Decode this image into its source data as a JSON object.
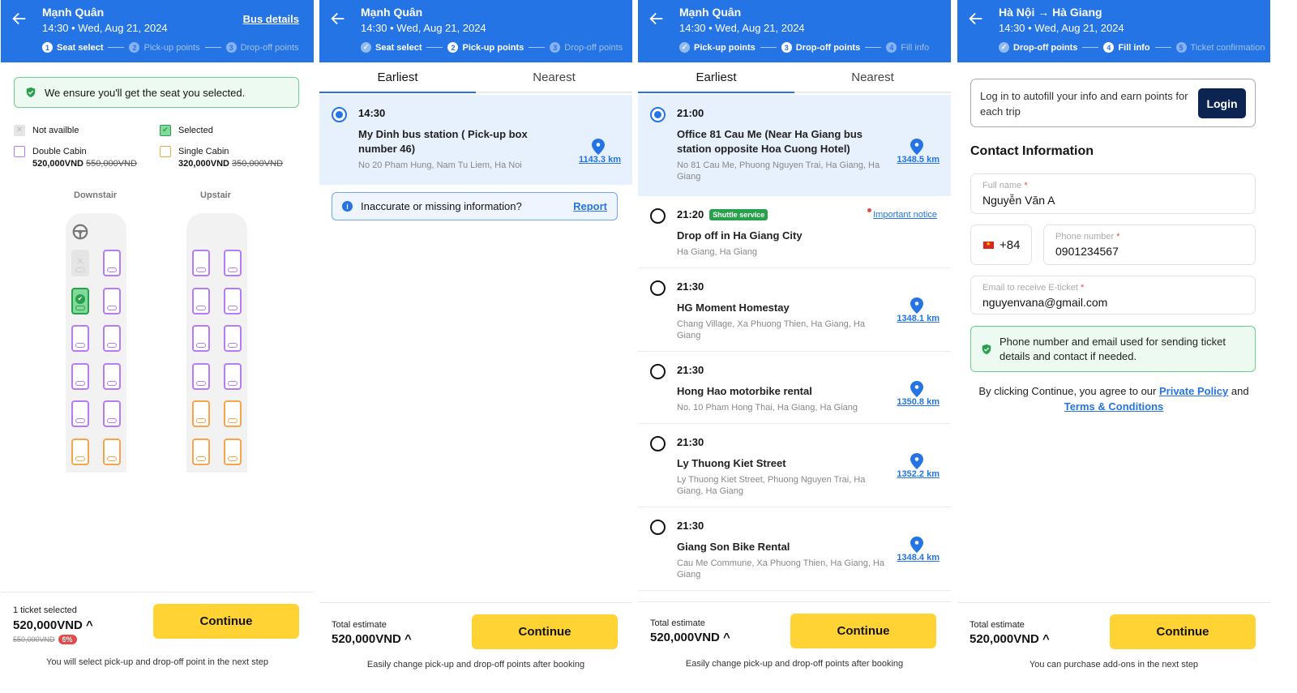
{
  "colors": {
    "primary": "#2474e5",
    "cta": "#ffd333",
    "success": "#27a14b",
    "double_cabin": "#b57cf5",
    "single_cabin": "#f5a54a",
    "discount": "#e34a4a",
    "login_btn": "#0b2451"
  },
  "screen1": {
    "title": "Mạnh Quân",
    "subtitle": "14:30 • Wed, Aug 21, 2024",
    "bus_details": "Bus details",
    "steps": [
      {
        "num": "1",
        "label": "Seat select",
        "state": "current"
      },
      {
        "num": "2",
        "label": "Pick-up points",
        "state": "future"
      },
      {
        "num": "3",
        "label": "Drop-off points",
        "state": "future"
      }
    ],
    "guarantee": "We ensure you'll get the seat you selected.",
    "legend": {
      "not_available": "Not availble",
      "selected": "Selected",
      "double_cabin": {
        "label": "Double Cabin",
        "price": "520,000VND",
        "old_price": "550,000VND"
      },
      "single_cabin": {
        "label": "Single Cabin",
        "price": "320,000VND",
        "old_price": "350,000VND"
      }
    },
    "decks": {
      "downstairs": "Downstair",
      "upstairs": "Upstair"
    },
    "seats_downstairs": [
      [
        "na",
        "double"
      ],
      [
        "selected",
        "double"
      ],
      [
        "double",
        "double"
      ],
      [
        "double",
        "double"
      ],
      [
        "double",
        "double"
      ],
      [
        "single",
        "single"
      ]
    ],
    "seats_upstairs": [
      [
        "double",
        "double"
      ],
      [
        "double",
        "double"
      ],
      [
        "double",
        "double"
      ],
      [
        "double",
        "double"
      ],
      [
        "single",
        "single"
      ],
      [
        "single",
        "single"
      ]
    ],
    "footer": {
      "label": "1 ticket selected",
      "price": "520,000VND ^",
      "old_price": "550,000VND",
      "discount": "6%",
      "button": "Continue",
      "note": "You will select pick-up and drop-off point in the next step"
    }
  },
  "screen2": {
    "title": "Mạnh Quân",
    "subtitle": "14:30 • Wed, Aug 21, 2024",
    "steps": [
      {
        "num": "✓",
        "label": "Seat select",
        "state": "done"
      },
      {
        "num": "2",
        "label": "Pick-up points",
        "state": "current"
      },
      {
        "num": "3",
        "label": "Drop-off points",
        "state": "future"
      }
    ],
    "tabs": [
      "Earliest",
      "Nearest"
    ],
    "points": [
      {
        "time": "14:30",
        "name": "My Dinh bus station ( Pick-up box number 46)",
        "address": "No 20 Pham Hung, Nam Tu Liem, Ha Noi",
        "distance": "1143.3 km",
        "selected": true
      }
    ],
    "info": {
      "text": "Inaccurate or missing information?",
      "link": "Report"
    },
    "footer": {
      "label": "Total estimate",
      "price": "520,000VND ^",
      "button": "Continue",
      "note": "Easily change pick-up and drop-off points after booking"
    }
  },
  "screen3": {
    "title": "Mạnh Quân",
    "subtitle": "14:30 • Wed, Aug 21, 2024",
    "steps": [
      {
        "num": "✓",
        "label": "Pick-up points",
        "state": "done"
      },
      {
        "num": "3",
        "label": "Drop-off points",
        "state": "current"
      },
      {
        "num": "4",
        "label": "Fill info",
        "state": "future"
      }
    ],
    "tabs": [
      "Earliest",
      "Nearest"
    ],
    "points": [
      {
        "time": "21:00",
        "name": "Office 81 Cau Me (Near Ha Giang bus station opposite Hoa Cuong Hotel)",
        "address": "No 81 Cau Me, Phuong Nguyen Trai, Ha Giang, Ha Giang",
        "distance": "1348.5 km",
        "selected": true
      },
      {
        "time": "21:20",
        "badge": "Shuttle service",
        "notice": "Important notice",
        "name": "Drop off in Ha Giang City",
        "address": "Ha Giang, Ha Giang",
        "selected": false
      },
      {
        "time": "21:30",
        "name": "HG Moment Homestay",
        "address": "Chang Village, Xa Phuong Thien, Ha Giang, Ha Giang",
        "distance": "1348.1 km",
        "selected": false
      },
      {
        "time": "21:30",
        "name": "Hong Hao motorbike rental",
        "address": "No. 10 Pham Hong Thai, Ha Giang, Ha Giang",
        "distance": "1350.8 km",
        "selected": false
      },
      {
        "time": "21:30",
        "name": "Ly Thuong Kiet Street",
        "address": "Ly Thuong Kiet Street, Phuong Nguyen Trai, Ha Giang, Ha Giang",
        "distance": "1352.2 km",
        "selected": false
      },
      {
        "time": "21:30",
        "name": "Giang Son Bike Rental",
        "address": "Cau Me Commune, Xa Phuong Thien, Ha Giang, Ha Giang",
        "distance": "1348.4 km",
        "selected": false
      }
    ],
    "footer": {
      "label": "Total estimate",
      "price": "520,000VND ^",
      "button": "Continue",
      "note": "Easily change pick-up and drop-off points after booking"
    }
  },
  "screen4": {
    "title": "Hà Nội → Hà Giang",
    "subtitle": "14:30 • Wed, Aug 21, 2024",
    "steps": [
      {
        "num": "✓",
        "label": "Drop-off points",
        "state": "done"
      },
      {
        "num": "4",
        "label": "Fill info",
        "state": "current"
      },
      {
        "num": "5",
        "label": "Ticket confirmation",
        "state": "future"
      }
    ],
    "login_text": "Log in to autofill your info and earn points for each trip",
    "login_button": "Login",
    "section_title": "Contact Information",
    "full_name": {
      "label": "Full name",
      "value": "Nguyễn Văn A"
    },
    "country_code": "+84",
    "phone": {
      "label": "Phone number",
      "value": "0901234567"
    },
    "email": {
      "label": "Email to receive E-ticket",
      "value": "nguyenvana@gmail.com"
    },
    "required_mark": "*",
    "note": "Phone number and email used for sending ticket details and contact if needed.",
    "terms": {
      "prefix": "By clicking Continue, you agree to our ",
      "privacy": "Private Policy",
      "and": " and ",
      "conditions": "Terms & Conditions"
    },
    "footer": {
      "label": "Total estimate",
      "price": "520,000VND ^",
      "button": "Continue",
      "note": "You can purchase add-ons in the next step"
    }
  }
}
